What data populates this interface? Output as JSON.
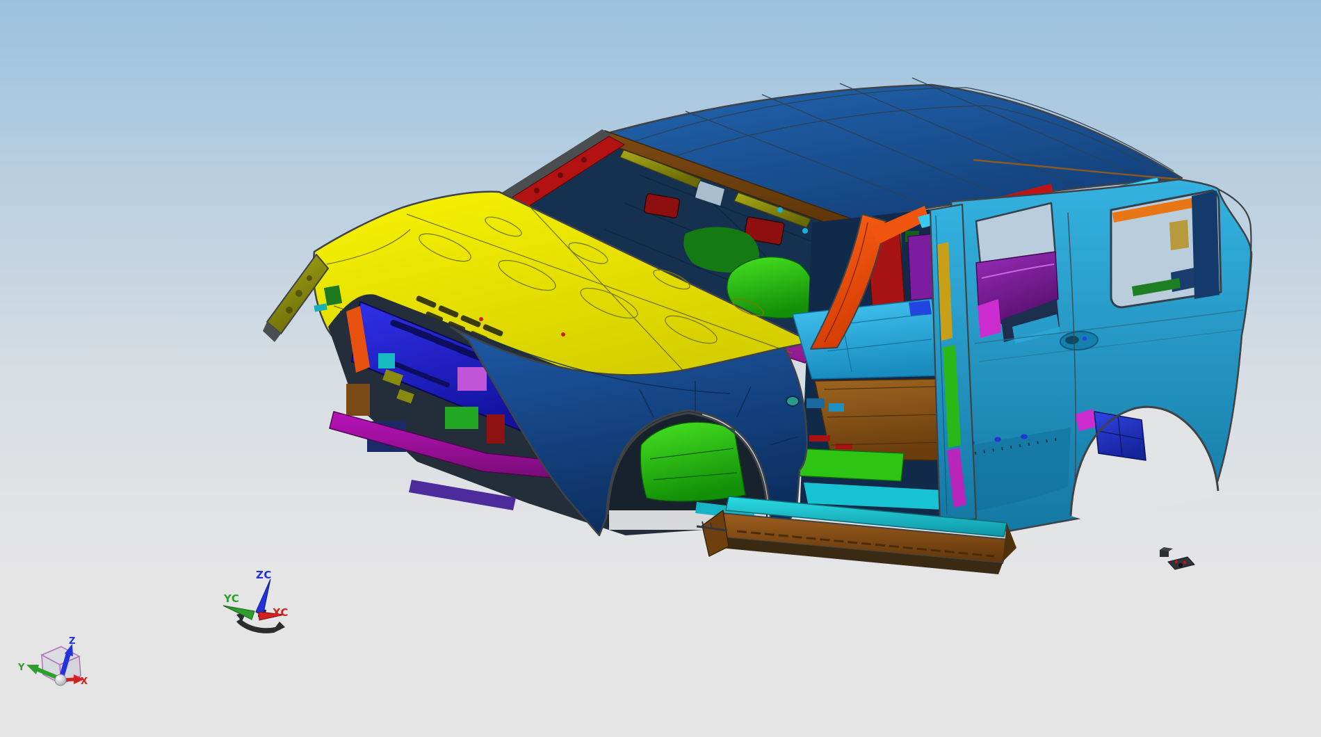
{
  "scene": {
    "type": "cad-3d-viewport",
    "content": "vehicle body-in-white shaded model, front-left isometric view"
  },
  "wcs_triad": {
    "z_label": "ZC",
    "y_label": "YC",
    "x_label": "XC"
  },
  "view_triad": {
    "z_label": "Z",
    "y_label": "Y",
    "x_label": "X"
  },
  "palette": {
    "bg_top": "#9cc1de",
    "bg_mid": "#d8dee3",
    "bg_bottom": "#e5e5e6",
    "outline": "#3f4347",
    "roof_hi": "#2265b0",
    "roof_lo": "#123e78",
    "header_brown": "#7e4a14",
    "header_brown_dk": "#5b3408",
    "hood_hi": "#f8f402",
    "hood_lo": "#d4cd00",
    "quarter_hi": "#35b2e0",
    "quarter_lo": "#1478a4",
    "fender_hi": "#1e5aa8",
    "fender_lo": "#0c2f60",
    "radiator_hi": "#3030ea",
    "radiator_lo": "#12129e",
    "beam_hi": "#ba12ba",
    "beam_lo": "#760c76",
    "cowl_hi": "#d832d8",
    "cowl_lo": "#8c1a8c",
    "purple_hi": "#9a2cba",
    "purple_lo": "#571070",
    "green_hi": "#46e222",
    "green_lo": "#129008",
    "floorcyan_hi": "#44c6f2",
    "floorcyan_lo": "#1a8cc0",
    "floorbrown_hi": "#9e6520",
    "floorbrown_lo": "#6b3d0d",
    "teal_hi": "#2adce4",
    "teal_lo": "#0e94a4",
    "sill_hi": "#9e5e1e",
    "sill_lo": "#5e350b",
    "arch_blue_hi": "#3044e2",
    "arch_blue_lo": "#16249c",
    "olive_hi": "#aaaa1a",
    "olive_lo": "#6a6a06",
    "apillar_orange_hi": "#ff6414",
    "apillar_orange_lo": "#d23c04",
    "interior_navy": "#15314f",
    "door_navy": "#122a4a",
    "deep_navy": "#143a6c",
    "visor_red": "#8e0f0f",
    "hvac_red": "#a81414",
    "accent_red": "#c01414",
    "mustard": "#c8a018",
    "seat_green": "#157a14",
    "pale_window": "#b9cddc",
    "pale_bg": "#e1e3e4",
    "bright_cyan": "#3fd2f4",
    "magenta_bright": "#cc2cd0",
    "violet": "#c055d8",
    "navy_block": "#1d2a6a",
    "purple_strip": "#4c2c9c",
    "brown_block": "#7a4a16",
    "khaki": "#b89a3c",
    "dark_part": "#2e3135",
    "axis_blue": "#2233dd",
    "axis_green": "#2f9e2f",
    "axis_red": "#d42222",
    "cube_edge": "#b070b8"
  }
}
